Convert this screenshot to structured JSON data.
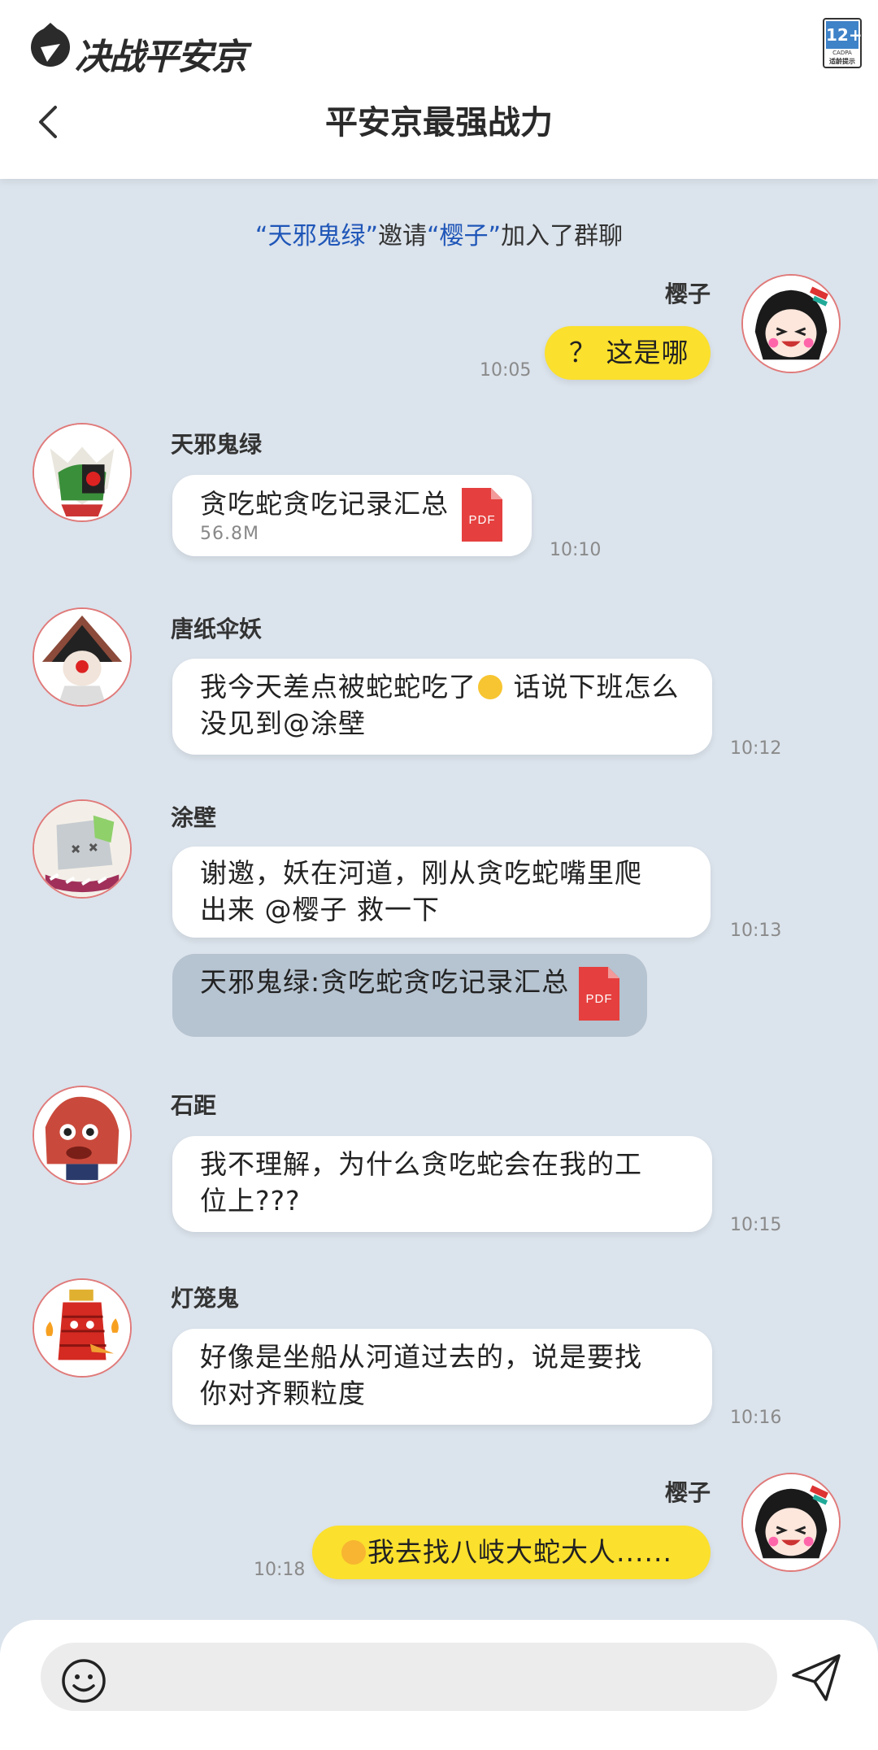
{
  "header": {
    "logo_text": "决战平安京",
    "age_rating": "12+",
    "age_label_top": "CADPA",
    "age_label_bottom": "适龄提示",
    "title": "平安京最强战力"
  },
  "system_message": {
    "inviter": "“天邪鬼绿”",
    "verb": "邀请",
    "invitee": "“樱子”",
    "suffix": "加入了群聊"
  },
  "messages": [
    {
      "sender": "樱子",
      "text": "？ 这是哪",
      "time": "10:05"
    },
    {
      "sender": "天邪鬼绿",
      "file_name": "贪吃蛇贪吃记录汇总",
      "file_size": "56.8M",
      "file_type": "PDF",
      "time": "10:10"
    },
    {
      "sender": "唐纸伞妖",
      "text_before": "我今天差点被蛇蛇吃了",
      "emoji": "crying-face",
      "text_after": " 话说下班怎么",
      "text_line2": "没见到@涂壁",
      "time": "10:12"
    },
    {
      "sender": "涂壁",
      "text_line1": "谢邀，妖在河道，刚从贪吃蛇嘴里爬",
      "text_line2": "出来 @樱子 救一下",
      "time": "10:13",
      "quote": "天邪鬼绿:贪吃蛇贪吃记录汇总",
      "quote_file_type": "PDF"
    },
    {
      "sender": "石距",
      "text_line1": "我不理解，为什么贪吃蛇会在我的工",
      "text_line2": "位上???",
      "time": "10:15"
    },
    {
      "sender": "灯笼鬼",
      "text_line1": "好像是坐船从河道过去的，说是要找",
      "text_line2": "你对齐颗粒度",
      "time": "10:16"
    },
    {
      "sender": "樱子",
      "emoji": "laughing-tears-face",
      "text": "我去找八岐大蛇大人......",
      "time": "10:18"
    }
  ],
  "colors": {
    "background": "#dbe3ec",
    "self_bubble": "#fbe02d",
    "other_bubble": "#ffffff",
    "quote_bubble": "#b6c3d0",
    "highlight_name": "#1f56b8",
    "pdf_icon": "#e5403f"
  }
}
